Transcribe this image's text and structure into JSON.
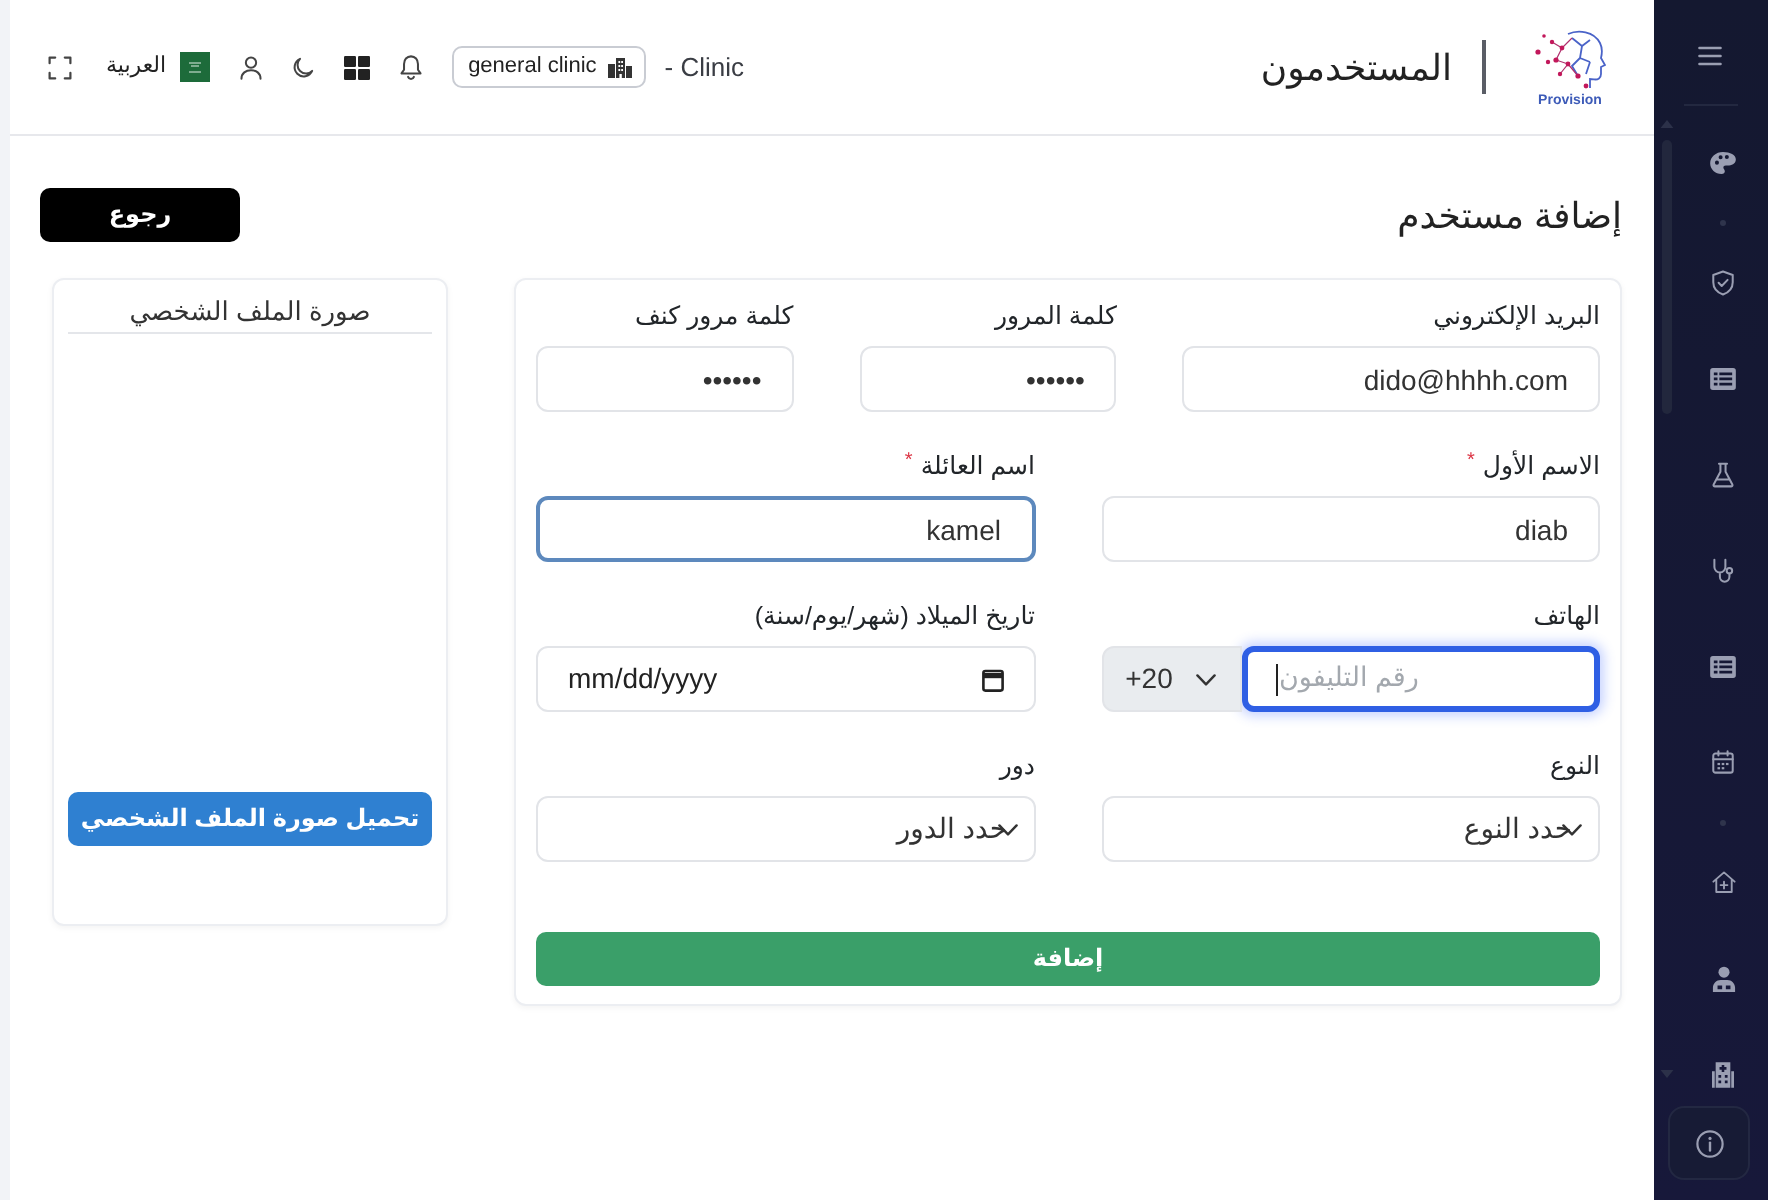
{
  "header": {
    "logo_text": "Provision",
    "title": "المستخدمون",
    "clinic_label": "- Clinic",
    "clinic_badge": "general clinic",
    "language": "العربية"
  },
  "page": {
    "title": "إضافة مستخدم",
    "back_button": "رجوع"
  },
  "form": {
    "rows": [
      [
        {
          "kind": "text",
          "label": "البريد الإلكتروني",
          "value": "dido@hhhh.com",
          "highlighted": false,
          "focused": false
        },
        {
          "kind": "password",
          "label": "كلمة المرور",
          "value": "••••••",
          "highlighted": false,
          "focused": false
        },
        {
          "kind": "password",
          "label": "كلمة مرور كنف",
          "value": "••••••",
          "highlighted": false,
          "focused": false
        }
      ],
      [
        {
          "kind": "text",
          "label": "الاسم الأول",
          "required_mark": "*",
          "value": "diab",
          "highlighted": false,
          "focused": false
        },
        {
          "kind": "text",
          "label": "اسم العائلة",
          "required_mark": "*",
          "value": "kamel",
          "highlighted": true,
          "focused": false
        }
      ],
      [
        {
          "kind": "phone",
          "label": "الهاتف",
          "country_code": "+20",
          "placeholder": "رقم التليفون",
          "highlighted": false,
          "focused": true
        },
        {
          "kind": "date",
          "label": "تاريخ الميلاد (شهر/يوم/سنة)",
          "placeholder": "mm/dd/yyyy",
          "highlighted": false,
          "focused": false
        }
      ],
      [
        {
          "kind": "select",
          "label": "النوع",
          "value": "حدد النوع",
          "highlighted": false,
          "focused": false
        },
        {
          "kind": "select",
          "label": "دور",
          "value": "حدد الدور",
          "highlighted": false,
          "focused": false
        }
      ]
    ],
    "submit_button": "إضافة"
  },
  "profile_card": {
    "title": "صورة الملف الشخصي",
    "upload_button": "تحميل صورة الملف الشخصي"
  }
}
